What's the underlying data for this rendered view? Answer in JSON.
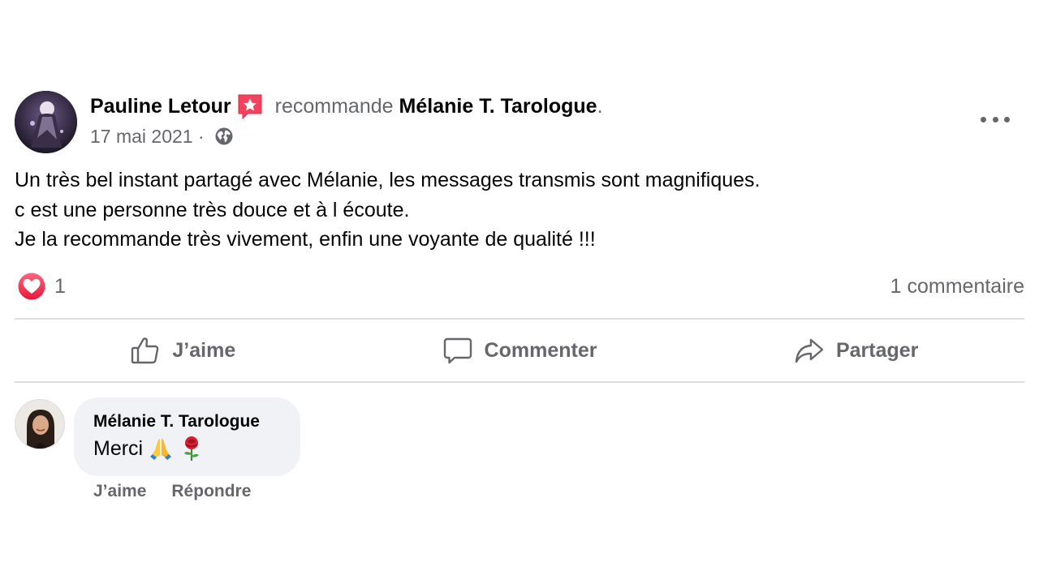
{
  "post": {
    "author": "Pauline Letour",
    "verb": "recommande",
    "page": "Mélanie T. Tarologue",
    "end_dot": ".",
    "date": "17 mai 2021",
    "date_separator": " · ",
    "audience_icon": "globe-icon",
    "body_lines": [
      "Un très bel instant partagé avec Mélanie, les messages transmis sont magnifiques.",
      "c est une personne très douce et à l écoute.",
      "Je la recommande très vivement, enfin une voyante de qualité !!!"
    ],
    "reaction_icon": "heart-icon",
    "reaction_count": "1",
    "comment_count": "1 commentaire"
  },
  "actions": {
    "like": "J’aime",
    "comment": "Commenter",
    "share": "Partager"
  },
  "comment": {
    "author": "Mélanie T. Tarologue",
    "text": "Merci",
    "emojis": [
      "folded-hands-icon",
      "rose-icon"
    ],
    "like": "J’aime",
    "reply": "Répondre"
  },
  "colors": {
    "text_primary": "#050505",
    "text_secondary": "#65676b",
    "divider": "#dadde1",
    "bubble": "#f0f2f5",
    "heart": "#f02849",
    "reco_badge": "#f3425f"
  }
}
